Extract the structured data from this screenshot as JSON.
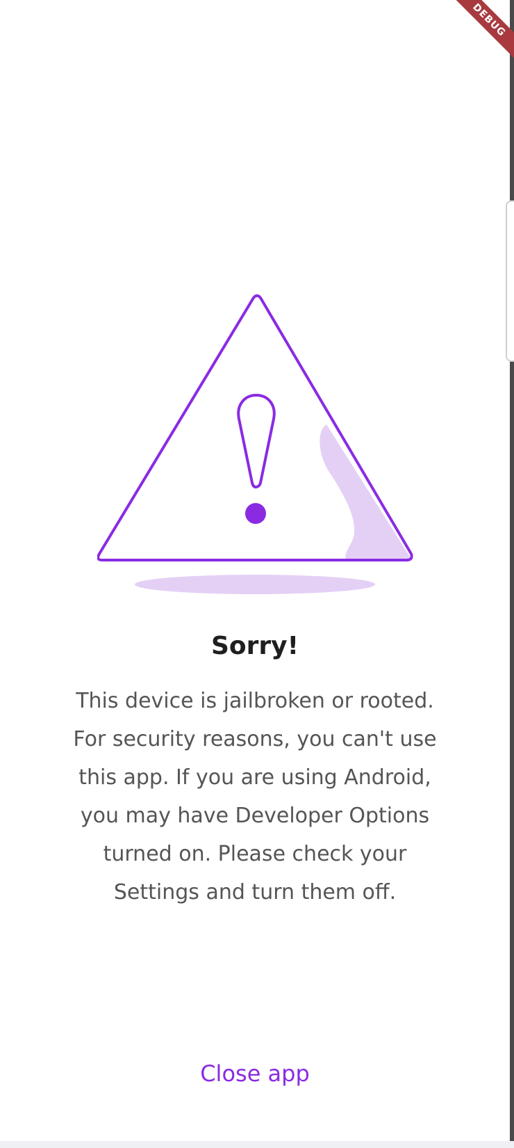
{
  "screen": {
    "debug_banner": "DEBUG",
    "title": "Sorry!",
    "message": "This device is jailbroken or rooted. For security reasons, you can't use this app. If you are using Android, you may have Developer Options turned on. Please check your Settings and turn them off.",
    "close_button_label": "Close app"
  },
  "colors": {
    "accent": "#8a2be2",
    "accent_light": "#e4d0f5",
    "title_text": "#1f1f1f",
    "body_text": "#555555",
    "debug_banner": "#a83a3f"
  },
  "icons": {
    "illustration": "warning-triangle-icon"
  }
}
